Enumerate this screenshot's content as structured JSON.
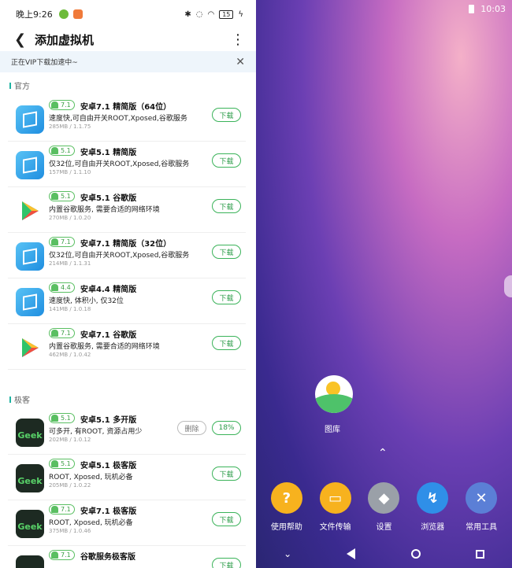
{
  "status": {
    "time": "晚上9:26",
    "battery": "15"
  },
  "appbar": {
    "title": "添加虚拟机"
  },
  "vip": {
    "text": "正在VIP下载加速中~"
  },
  "sections": {
    "official": "官方",
    "geek": "极客"
  },
  "official_items": [
    {
      "version": "7.1",
      "name": "安卓7.1 精简版（64位）",
      "desc": "速度快,可自由开关ROOT,Xposed,谷歌服务",
      "meta": "285MB / 1.1.75",
      "action": "下载",
      "icon": "vm-icon"
    },
    {
      "version": "5.1",
      "name": "安卓5.1 精简版",
      "desc": "仅32位,可自由开关ROOT,Xposed,谷歌服务",
      "meta": "157MB / 1.1.10",
      "action": "下载",
      "icon": "vm-icon"
    },
    {
      "version": "5.1",
      "name": "安卓5.1 谷歌版",
      "desc": "内置谷歌服务, 需要合适的网络环境",
      "meta": "270MB / 1.0.20",
      "action": "下载",
      "icon": "play-icon"
    },
    {
      "version": "7.1",
      "name": "安卓7.1 精简版（32位）",
      "desc": "仅32位,可自由开关ROOT,Xposed,谷歌服务",
      "meta": "214MB / 1.1.31",
      "action": "下载",
      "icon": "vm-icon"
    },
    {
      "version": "4.4",
      "name": "安卓4.4 精简版",
      "desc": "速度快, 体积小, 仅32位",
      "meta": "141MB / 1.0.18",
      "action": "下载",
      "icon": "vm-icon"
    },
    {
      "version": "7.1",
      "name": "安卓7.1 谷歌版",
      "desc": "内置谷歌服务, 需要合适的网络环境",
      "meta": "462MB / 1.0.42",
      "action": "下载",
      "icon": "play-icon"
    }
  ],
  "geek_items": [
    {
      "version": "5.1",
      "name": "安卓5.1 多开版",
      "desc": "可多开, 有ROOT, 资源占用少",
      "meta": "202MB / 1.0.12",
      "action": "18%",
      "delete": "删除",
      "icon": "geek-icon"
    },
    {
      "version": "5.1",
      "name": "安卓5.1 极客版",
      "desc": "ROOT, Xposed, 玩机必备",
      "meta": "205MB / 1.0.22",
      "action": "下载",
      "icon": "geek-icon"
    },
    {
      "version": "7.1",
      "name": "安卓7.1 极客版",
      "desc": "ROOT, Xposed, 玩机必备",
      "meta": "375MB / 1.0.46",
      "action": "下载",
      "icon": "geek-icon"
    },
    {
      "version": "7.1",
      "name": "谷歌服务极客版",
      "desc": "",
      "meta": "",
      "action": "下载",
      "icon": "geek-icon"
    }
  ],
  "geek_label": "Geek",
  "vm": {
    "time": "10:03",
    "gallery_label": "图库",
    "dock": [
      {
        "label": "使用帮助",
        "glyph": "?",
        "color": "#f7b21e"
      },
      {
        "label": "文件传输",
        "glyph": "▭",
        "color": "#f7b21e"
      },
      {
        "label": "设置",
        "glyph": "◆",
        "color": "#9aa0a8"
      },
      {
        "label": "浏览器",
        "glyph": "↯",
        "color": "#2f8fe8"
      },
      {
        "label": "常用工具",
        "glyph": "✕",
        "color": "#5b7fd6"
      }
    ]
  }
}
